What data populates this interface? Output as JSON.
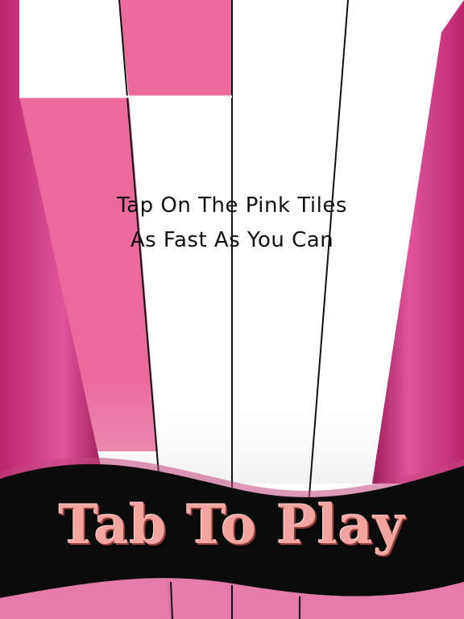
{
  "game": {
    "instruction_line1": "Tap On The Pink Tiles",
    "instruction_line2": "As Fast As You Can",
    "play_label": "Tab To Play"
  },
  "board": {
    "columns": 4,
    "highlighted_tiles": [
      {
        "row": "top",
        "column": 2
      },
      {
        "row": "second",
        "column": 1
      }
    ]
  },
  "colors": {
    "tile_pink": "#ea6a9c",
    "side_pink": "#d33f82",
    "tile_white": "#ffffff",
    "banner_black": "#0b0b0b",
    "play_text": "#f4a4a0"
  }
}
